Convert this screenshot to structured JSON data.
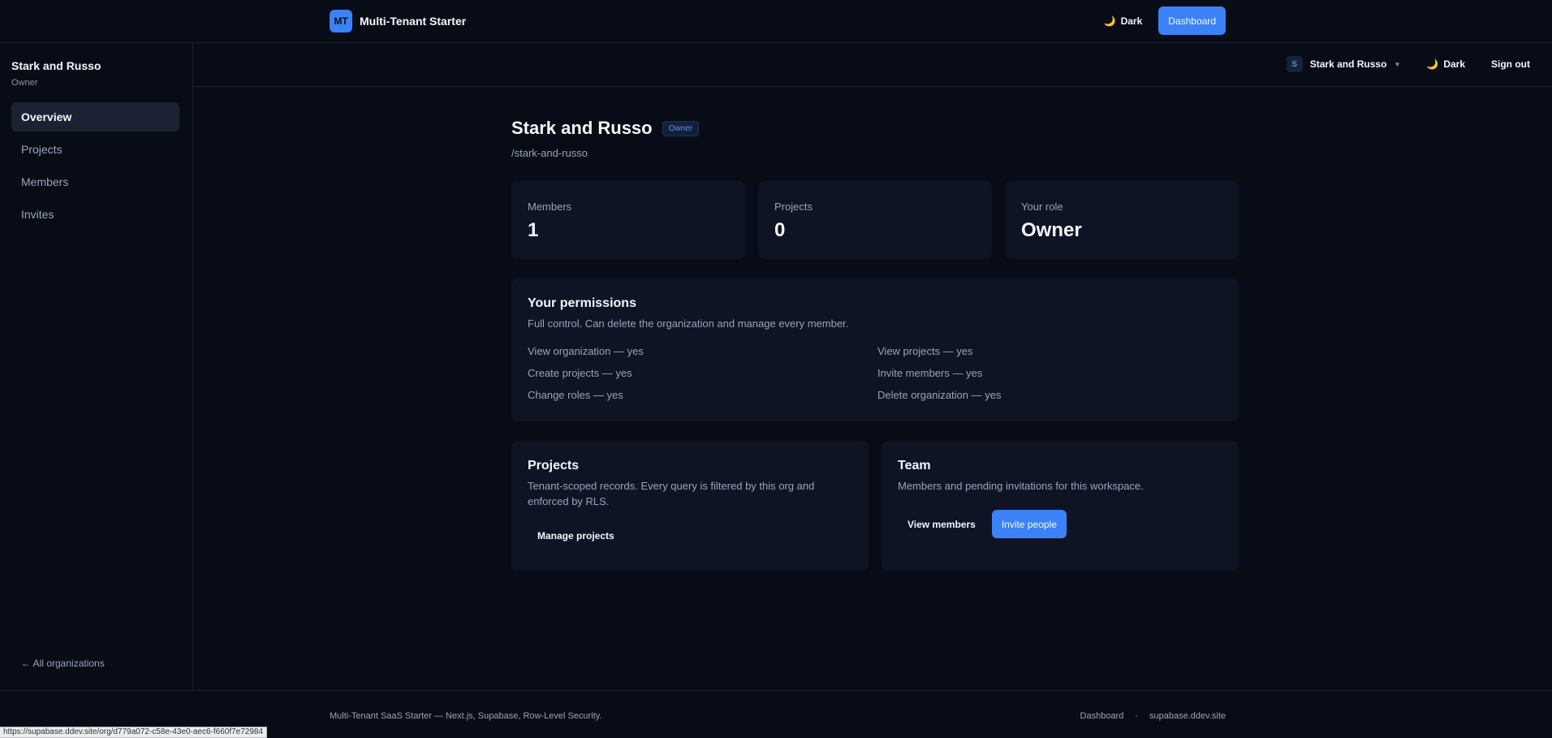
{
  "header": {
    "logo_text": "MT",
    "app_name": "Multi-Tenant Starter",
    "theme_label": "Dark",
    "dashboard_button": "Dashboard"
  },
  "sidebar": {
    "org_name": "Stark and Russo",
    "org_role": "Owner",
    "items": [
      {
        "label": "Overview",
        "active": true
      },
      {
        "label": "Projects",
        "active": false
      },
      {
        "label": "Members",
        "active": false
      },
      {
        "label": "Invites",
        "active": false
      }
    ],
    "back_link": "← All organizations"
  },
  "subheader": {
    "org_avatar": "S",
    "org_switcher": "Stark and Russo",
    "theme_label": "Dark",
    "sign_out": "Sign out"
  },
  "main": {
    "title": "Stark and Russo",
    "role_badge": "Owner",
    "slug": "/stark-and-russo",
    "stats": [
      {
        "label": "Members",
        "value": "1"
      },
      {
        "label": "Projects",
        "value": "0"
      },
      {
        "label": "Your role",
        "value": "Owner"
      }
    ],
    "permissions": {
      "title": "Your permissions",
      "description": "Full control. Can delete the organization and manage every member.",
      "items": [
        "View organization — yes",
        "View projects — yes",
        "Create projects — yes",
        "Invite members — yes",
        "Change roles — yes",
        "Delete organization — yes"
      ]
    },
    "projects_card": {
      "title": "Projects",
      "description": "Tenant-scoped records. Every query is filtered by this org and enforced by RLS.",
      "button": "Manage projects"
    },
    "team_card": {
      "title": "Team",
      "description": "Members and pending invitations for this workspace.",
      "button_secondary": "View members",
      "button_primary": "Invite people"
    }
  },
  "footer": {
    "text": "Multi-Tenant SaaS Starter — Next.js, Supabase, Row-Level Security.",
    "link1": "Dashboard",
    "separator": "·",
    "link2": "supabase.ddev.site"
  },
  "status_bar_url": "https://supabase.ddev.site/org/d779a072-c58e-43e0-aec6-f660f7e72984",
  "colors": {
    "background": "#080c17",
    "card": "#0e1424",
    "accent": "#3b82f6",
    "muted_text": "#9aa4b8"
  },
  "icons": {
    "theme": "moon-icon",
    "org_switcher": "chevron-down-icon"
  }
}
